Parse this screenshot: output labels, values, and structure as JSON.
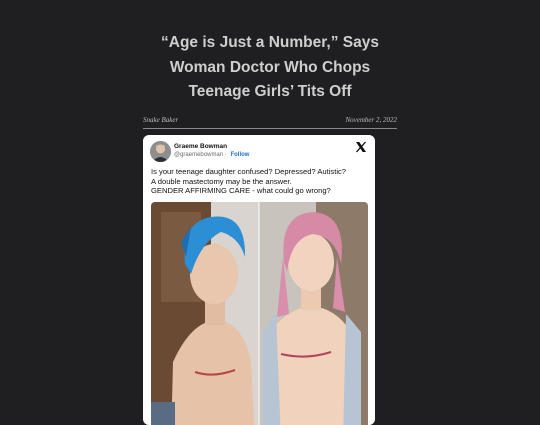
{
  "article": {
    "title_lines": [
      "“Age is Just a Number,” Says",
      "Woman Doctor Who Chops",
      "Teenage Girls’ Tits Off"
    ],
    "author": "Snake Baker",
    "date": "November 2, 2022"
  },
  "tweet": {
    "user_name": "Graeme Bowman",
    "handle": "@graemebowman",
    "separator": " · ",
    "follow_label": "Follow",
    "brand_icon": "x-logo-icon",
    "text_lines": [
      "Is your teenage daughter confused? Depressed? Autistic?",
      "A double mastectomy may be the answer.",
      "GENDER AFFIRMING CARE - what could go wrong?"
    ]
  }
}
